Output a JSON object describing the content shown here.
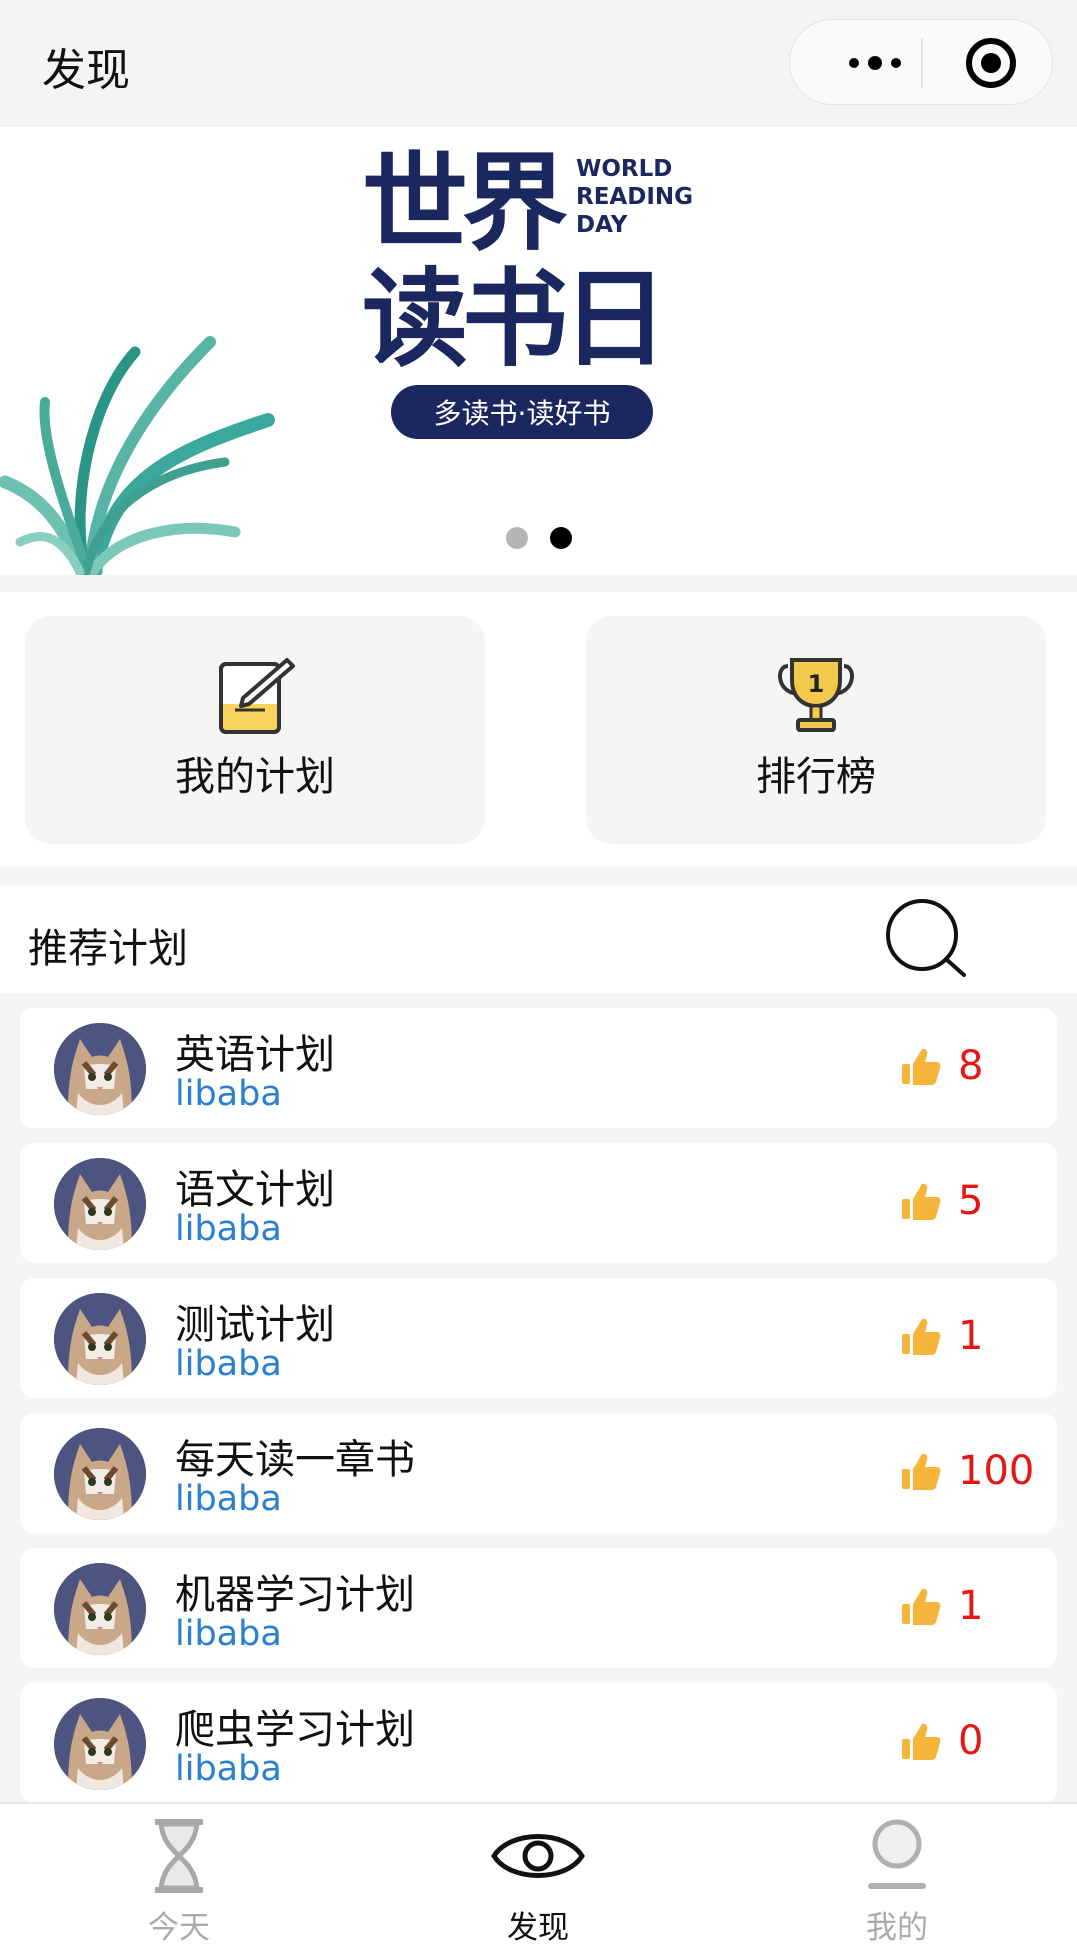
{
  "header": {
    "title": "发现"
  },
  "banner": {
    "title_line1": "世界",
    "title_line2": "读书日",
    "title_en": [
      "WORLD",
      "READING",
      "DAY"
    ],
    "slogan": "多读书·读好书",
    "pages": 2,
    "active_page": 2
  },
  "quick": [
    {
      "label": "我的计划",
      "icon": "notepad-pen-icon"
    },
    {
      "label": "排行榜",
      "icon": "trophy-icon",
      "badge": "1"
    }
  ],
  "section": {
    "title": "推荐计划"
  },
  "plans": [
    {
      "name": "英语计划",
      "user": "libaba",
      "likes": "8"
    },
    {
      "name": "语文计划",
      "user": "libaba",
      "likes": "5"
    },
    {
      "name": "测试计划",
      "user": "libaba",
      "likes": "1"
    },
    {
      "name": "每天读一章书",
      "user": "libaba",
      "likes": "100"
    },
    {
      "name": "机器学习计划",
      "user": "libaba",
      "likes": "1"
    },
    {
      "name": "爬虫学习计划",
      "user": "libaba",
      "likes": "0"
    }
  ],
  "tabbar": [
    {
      "label": "今天",
      "icon": "hourglass-icon",
      "active": false
    },
    {
      "label": "发现",
      "icon": "eye-icon",
      "active": true
    },
    {
      "label": "我的",
      "icon": "user-icon",
      "active": false
    }
  ],
  "colors": {
    "accent_blue": "#2a7fd0",
    "likes_red": "#e81515",
    "banner_navy": "#1b2860",
    "thumb_gold": "#f5b43a"
  }
}
